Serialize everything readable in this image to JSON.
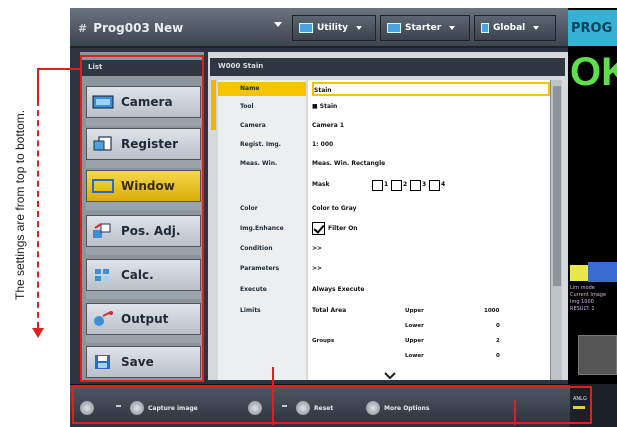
{
  "topbar": {
    "program_number": "#",
    "program_name": "Prog003 New",
    "buttons": [
      {
        "label": "Utility"
      },
      {
        "label": "Starter"
      },
      {
        "label": "Global"
      }
    ]
  },
  "status": {
    "program_label": "PROG",
    "result": "OK",
    "info_lines": [
      "Lim mode",
      "Current Image",
      "Img 1000",
      "RESULT: 1"
    ]
  },
  "list": {
    "header": "List",
    "items": [
      {
        "label": "Camera",
        "icon": "camera-icon",
        "active": false
      },
      {
        "label": "Register",
        "icon": "register-icon",
        "active": false
      },
      {
        "label": "Window",
        "icon": "window-icon",
        "active": true
      },
      {
        "label": "Pos. Adj.",
        "icon": "position-adjust-icon",
        "active": false
      },
      {
        "label": "Calc.",
        "icon": "calc-icon",
        "active": false
      },
      {
        "label": "Output",
        "icon": "output-icon",
        "active": false
      },
      {
        "label": "Save",
        "icon": "save-icon",
        "active": false
      }
    ]
  },
  "settings": {
    "header": "W000 Stain",
    "rows": [
      {
        "label": "Name",
        "value": "Stain",
        "active": true
      },
      {
        "label": "Tool",
        "value": "■ Stain",
        "active": false
      },
      {
        "label": "Camera",
        "value": "Camera 1",
        "active": false
      },
      {
        "label": "Regist. Img.",
        "value": "1: 000",
        "active": false
      },
      {
        "label": "Meas. Win.",
        "value": "Meas. Win. Rectangle",
        "active": false
      },
      {
        "label": "",
        "value": "Mask",
        "active": false
      },
      {
        "label": "Color",
        "value": "Color to Gray",
        "active": false
      },
      {
        "label": "Img.Enhance",
        "value": "Filter On",
        "active": false
      },
      {
        "label": "Condition",
        "value": ">>",
        "active": false
      },
      {
        "label": "Parameters",
        "value": ">>",
        "active": false
      },
      {
        "label": "Execute",
        "value": "Always Execute",
        "active": false
      },
      {
        "label": "Limits",
        "value": "Total Area",
        "active": false
      }
    ],
    "mask_options": [
      "1",
      "2",
      "3",
      "4"
    ],
    "limits": {
      "total_area": {
        "upper_label": "Upper",
        "upper_value": "1000",
        "lower_label": "Lower",
        "lower_value": "0"
      },
      "groups_label": "Groups",
      "groups": {
        "upper_label": "Upper",
        "upper_value": "2",
        "lower_label": "Lower",
        "lower_value": "0"
      }
    }
  },
  "bottombar": {
    "buttons": [
      {
        "label": ""
      },
      {
        "label": "Capture image"
      },
      {
        "label": ""
      },
      {
        "label": "Reset"
      },
      {
        "label": "More Options"
      }
    ],
    "right_text": "ANLG"
  },
  "annotation": {
    "note": "The settings are from top to bottom."
  },
  "colors": {
    "accent": "#f4c400",
    "annotation": "#e0201c",
    "ok": "#5ee04a",
    "program_label_bg": "#36b3d4"
  }
}
